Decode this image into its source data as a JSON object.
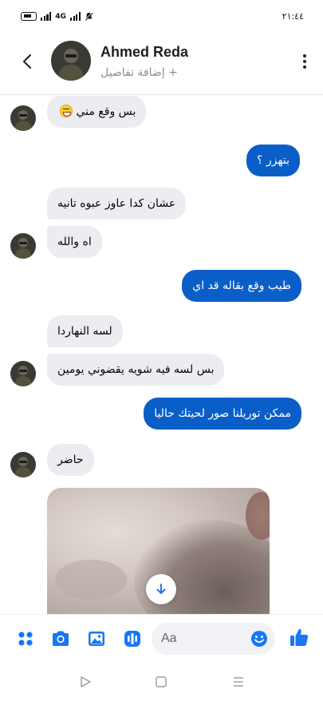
{
  "status_bar": {
    "network_label": "4G",
    "time": "٢١:٤٤"
  },
  "header": {
    "contact_name": "Ahmed Reda",
    "subtitle": "+ إضافة تفاصيل",
    "back_icon": "chevron-left-icon",
    "more_icon": "vertical-dots-icon"
  },
  "messages": [
    {
      "direction": "in",
      "text": "بس وقع مني",
      "emoji": "laughing-face-emoji"
    },
    {
      "direction": "out",
      "text": "بتهزر ؟"
    },
    {
      "direction": "in",
      "text": "عشان كدا عاوز عبوه تانيه"
    },
    {
      "direction": "in",
      "text": "اه والله"
    },
    {
      "direction": "out",
      "text": "طيب وقع بقاله قد اي"
    },
    {
      "direction": "in",
      "text": "لسه النهاردا"
    },
    {
      "direction": "in",
      "text": "بس لسه فيه شويه يقضوني يومين"
    },
    {
      "direction": "out",
      "text": "ممكن توريلنا صور لحيتك حاليا"
    },
    {
      "direction": "in",
      "text": "حاضر"
    }
  ],
  "composer": {
    "placeholder": "Aa",
    "icons": [
      "menu-grid-icon",
      "camera-icon",
      "gallery-icon",
      "voice-icon",
      "emoji-icon",
      "like-icon"
    ]
  },
  "colors": {
    "accent": "#0a5ec8",
    "incoming_bubble": "#ebedf0",
    "icon_blue": "#1877f2"
  }
}
